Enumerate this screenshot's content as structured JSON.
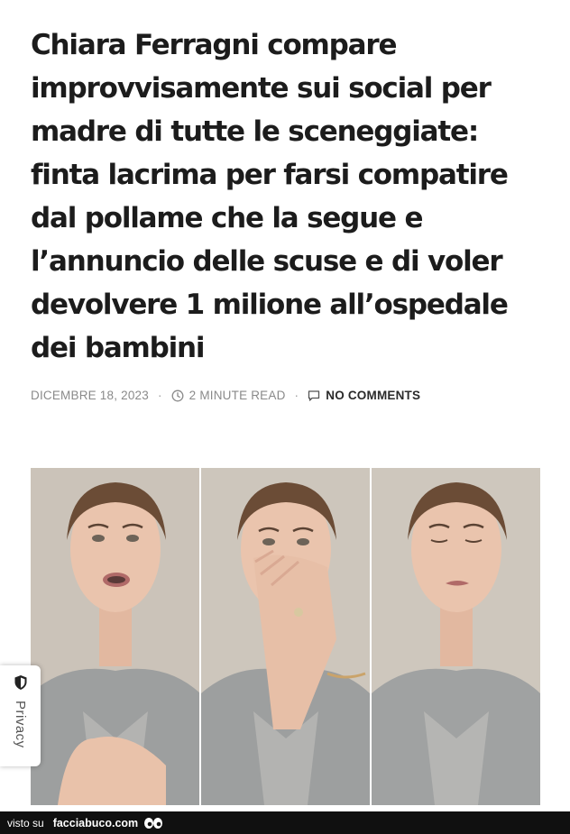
{
  "article": {
    "title": "Chiara Ferragni compare improvvisamente sui social per madre di tutte le sceneggiate: finta lacrima per farsi compatire dal pollame che la segue e l’annuncio delle scuse e di voler devolvere 1 milione all’ospedale dei bambini",
    "date": "DICEMBRE 18, 2023",
    "read_time": "2 MINUTE READ",
    "comments": "NO COMMENTS",
    "separator": "·"
  },
  "privacy_tab": {
    "label": "Privacy",
    "icon": "shield-icon"
  },
  "footer": {
    "prefix": "visto su",
    "site": "facciabuco.com",
    "logo_icon": "eyes-icon"
  },
  "colors": {
    "text": "#1c1c1c",
    "meta": "#8a8a8a",
    "footer_bg": "#101010"
  }
}
